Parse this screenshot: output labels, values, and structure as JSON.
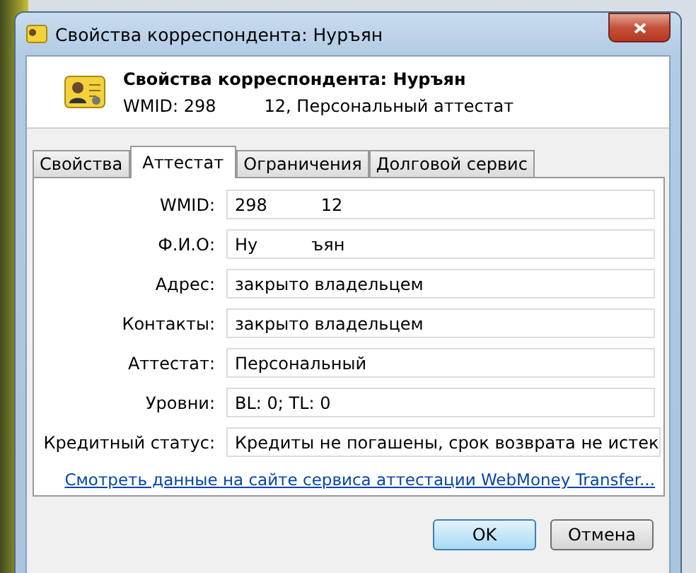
{
  "window": {
    "title": "Свойства корреспондента: Нуръян"
  },
  "header": {
    "title": "Свойства корреспондента: Нуръян",
    "subtitle_start": "WMID: 298",
    "subtitle_end": "12, Персональный аттестат"
  },
  "tabs": [
    {
      "label": "Свойства",
      "selected": false
    },
    {
      "label": "Аттестат",
      "selected": true
    },
    {
      "label": "Ограничения",
      "selected": false
    },
    {
      "label": "Долговой сервис",
      "selected": false
    }
  ],
  "fields": [
    {
      "label": "WMID:",
      "value": "298",
      "value_end": "12"
    },
    {
      "label": "Ф.И.О:",
      "value": "Ну",
      "value_end": "ъян"
    },
    {
      "label": "Адрес:",
      "value": "закрыто владельцем"
    },
    {
      "label": "Контакты:",
      "value": "закрыто владельцем"
    },
    {
      "label": "Аттестат:",
      "value": "Персональный"
    },
    {
      "label": "Уровни:",
      "value": "BL: 0; TL: 0"
    },
    {
      "label": "Кредитный статус:",
      "value": "Кредиты не погашены, срок возврата не истек"
    }
  ],
  "link": "Смотреть данные на сайте сервиса аттестации WebMoney Transfer...",
  "buttons": [
    {
      "label": "OK",
      "kind": "default"
    },
    {
      "label": "Отмена",
      "kind": "normal"
    }
  ]
}
